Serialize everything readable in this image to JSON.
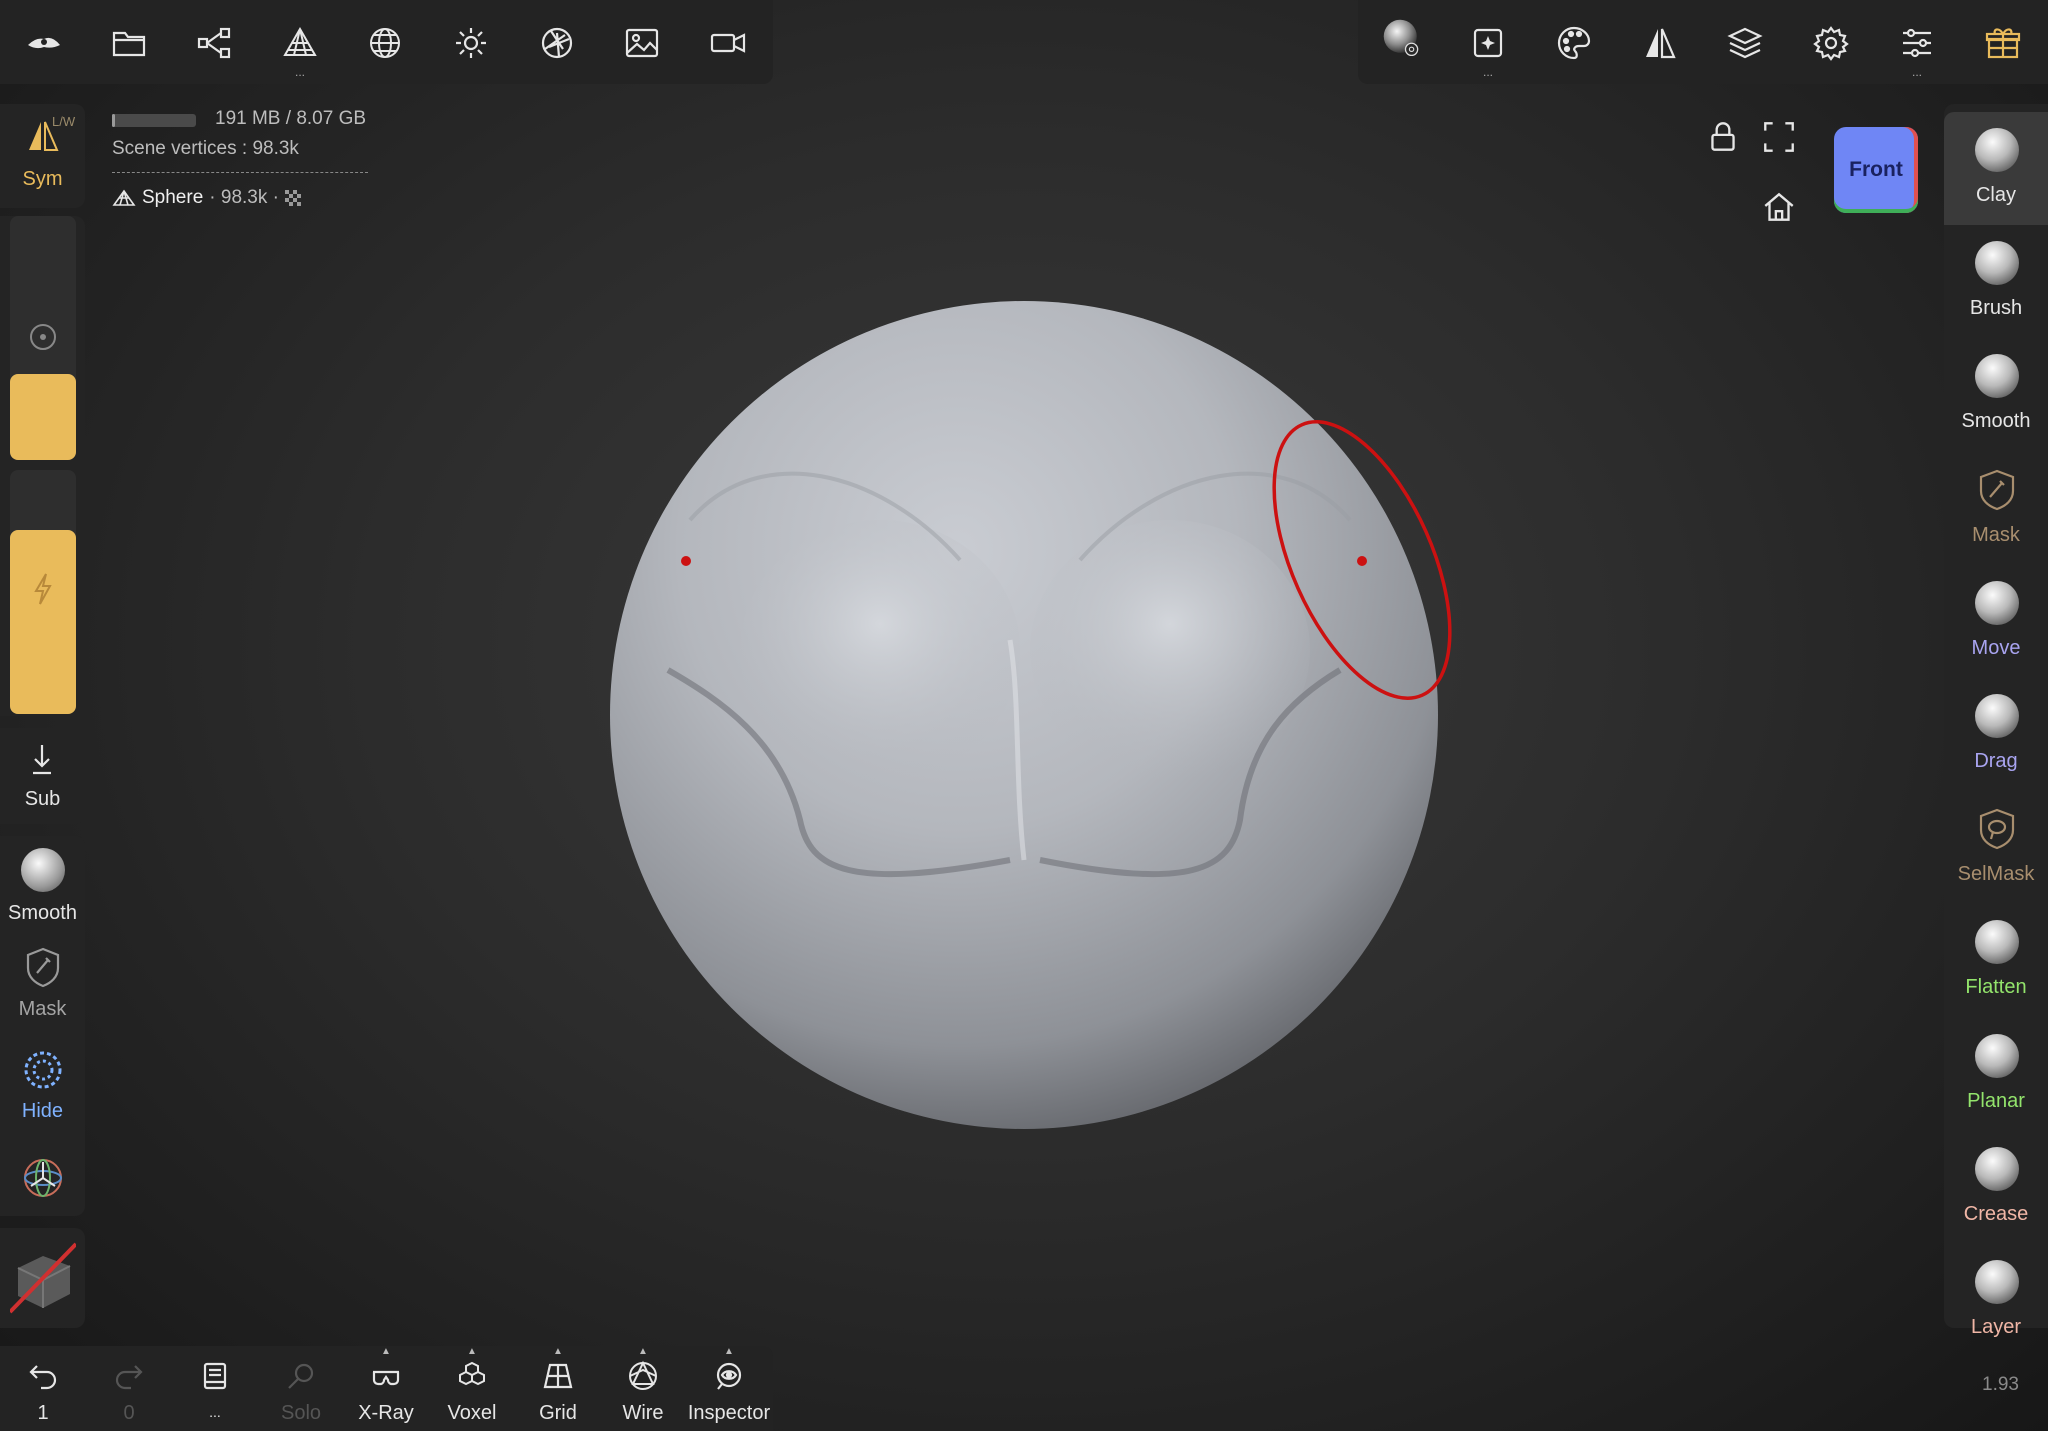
{
  "top_toolbar_left": {
    "icons": [
      "nomad-logo-icon",
      "folder-icon",
      "share-nodes-icon",
      "mesh-pyramid-icon",
      "sphere-grid-icon",
      "sun-icon",
      "aperture-icon",
      "image-icon",
      "video-camera-icon"
    ]
  },
  "top_toolbar_right": {
    "icons": [
      "material-matcap-icon",
      "frame-sparkle-icon",
      "palette-icon",
      "symmetry-triangle-icon",
      "layers-icon",
      "gear-icon",
      "sliders-icon",
      "gift-icon"
    ]
  },
  "left_panel": {
    "sym_badge": "L/W",
    "sym_label": "Sym",
    "sub_label": "Sub",
    "smooth_label": "Smooth",
    "mask_label": "Mask",
    "hide_label": "Hide"
  },
  "info": {
    "memory": "191 MB / 8.07 GB",
    "memory_fraction": 0.03,
    "scene_vertices": "Scene vertices :  98.3k",
    "object_name": "Sphere",
    "object_vertices": "· 98.3k ·"
  },
  "view_cube": {
    "label": "Front",
    "color": "#6f86f5"
  },
  "brushes": [
    {
      "label": "Clay",
      "color": "#e6e6e6"
    },
    {
      "label": "Brush",
      "color": "#e6e6e6"
    },
    {
      "label": "Smooth",
      "color": "#e6e6e6"
    },
    {
      "label": "Mask",
      "color": "#a88e6e"
    },
    {
      "label": "Move",
      "color": "#a9a4f0"
    },
    {
      "label": "Drag",
      "color": "#a9a4f0"
    },
    {
      "label": "SelMask",
      "color": "#a88e6e"
    },
    {
      "label": "Flatten",
      "color": "#93e46c"
    },
    {
      "label": "Planar",
      "color": "#93e46c"
    },
    {
      "label": "Crease",
      "color": "#f0b6a6"
    },
    {
      "label": "Layer",
      "color": "#f0b6a6"
    }
  ],
  "bottom_toolbar": {
    "undo_count": "1",
    "redo_count": "0",
    "more_label": "...",
    "solo_label": "Solo",
    "xray_label": "X-Ray",
    "voxel_label": "Voxel",
    "grid_label": "Grid",
    "wire_label": "Wire",
    "inspector_label": "Inspector"
  },
  "version": "1.93",
  "colors": {
    "accent_yellow": "#e9bb5b",
    "annotation_red": "#cc1111",
    "hide_blue": "#7fb2ff"
  }
}
